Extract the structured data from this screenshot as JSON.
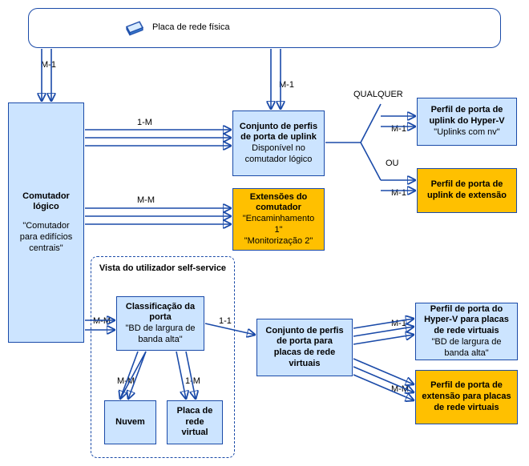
{
  "nodes": {
    "physical_nic": {
      "title": "Placa de rede física"
    },
    "logical_switch": {
      "title": "Comutador lógico",
      "sub": "\"Comutador para edifícios centrais\""
    },
    "uplink_set": {
      "title": "Conjunto de perfis de porta de uplink",
      "sub": "Disponível no comutador lógico"
    },
    "switch_extensions": {
      "title": "Extensões do comutador",
      "sub": "\"Encaminhamento 1\"\n\"Monitorização 2\""
    },
    "hyperv_uplink_profile": {
      "title": "Perfil de porta de uplink do Hyper-V",
      "sub": "\"Uplinks com nv\""
    },
    "ext_uplink_profile": {
      "title": "Perfil de porta de uplink de extensão"
    },
    "port_class": {
      "title": "Classificação da porta",
      "sub": "\"BD de largura de banda alta\""
    },
    "cloud": {
      "title": "Nuvem"
    },
    "virtual_nic": {
      "title": "Placa de rede virtual"
    },
    "vnic_set": {
      "title": "Conjunto de perfis de porta para placas de rede virtuais"
    },
    "hyperv_vnic_profile": {
      "title": "Perfil de porta do Hyper-V para placas de rede virtuais",
      "sub": "\"BD de largura de banda alta\""
    },
    "ext_vnic_profile": {
      "title": "Perfil de porta de extensão para placas de rede virtuais"
    }
  },
  "frame": {
    "title": "Vista do utilizador self-service"
  },
  "labels": {
    "m1_a": "M-1",
    "m1_b": "M-1",
    "one_m": "1-M",
    "m_m": "M-M",
    "qualquer": "QUALQUER",
    "m1_c": "M-1",
    "ou": "OU",
    "m1_d": "M-1",
    "mm_pc": "M-M",
    "one_one": "1-1",
    "mm_cloud": "M-M",
    "one_m_vnic": "1-M",
    "m1_e": "M-1",
    "mm_f": "M-M"
  }
}
